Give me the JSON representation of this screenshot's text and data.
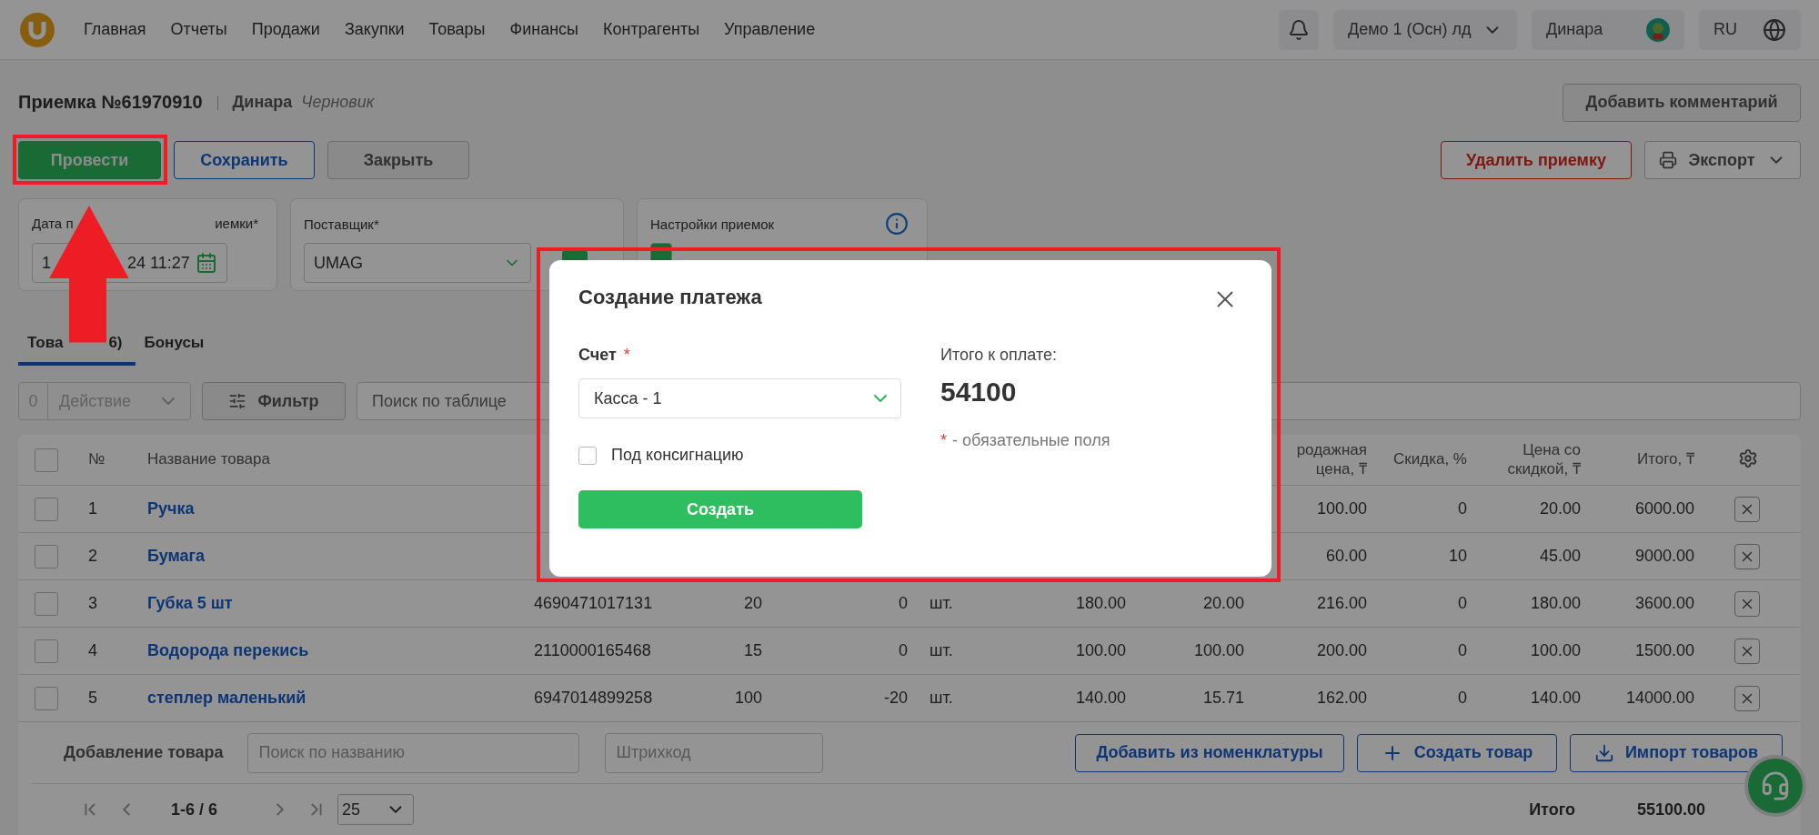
{
  "nav": {
    "items": [
      "Главная",
      "Отчеты",
      "Продажи",
      "Закупки",
      "Товары",
      "Финансы",
      "Контрагенты",
      "Управление"
    ],
    "organization": "Демо 1 (Осн) лд",
    "user": "Динара",
    "language": "RU"
  },
  "document": {
    "title": "Приемка №61970910",
    "author": "Динара",
    "status": "Черновик"
  },
  "buttons": {
    "conduct": "Провести",
    "save": "Сохранить",
    "close": "Закрыть",
    "add_comment": "Добавить комментарий",
    "delete": "Удалить приемку",
    "export": "Экспорт"
  },
  "cards": {
    "date": {
      "label_parts": [
        "Дата п",
        "иемки*"
      ],
      "value_parts": [
        "1",
        "24 11:27"
      ]
    },
    "supplier": {
      "label": "Поставщик*",
      "value": "UMAG"
    },
    "settings": {
      "label": "Настройки приемок",
      "checked": true
    }
  },
  "tabs": [
    {
      "label_parts": [
        "Това",
        "6)"
      ],
      "selected": true
    },
    {
      "label_parts": [
        "Бонусы"
      ],
      "selected": false
    }
  ],
  "toolbar": {
    "selected_count": "0",
    "action": "Действие",
    "filter": "Фильтр",
    "search_placeholder": "Поиск по таблице"
  },
  "table": {
    "select_all_checked": false,
    "columns": {
      "number": "№",
      "name": "Название товара",
      "sale_price": "родажная\nцена, ₸",
      "discount": "Скидка, %",
      "discounted_price": "Цена со\nскидкой, ₸",
      "total": "Итого, ₸"
    },
    "rows": [
      {
        "checked": false,
        "number": "1",
        "name": "Ручка",
        "sale_price": "100.00",
        "discount": "0",
        "discounted_price": "20.00",
        "total": "6000.00"
      },
      {
        "checked": false,
        "number": "2",
        "name": "Бумага",
        "sale_price": "60.00",
        "discount": "10",
        "discounted_price": "45.00",
        "total": "9000.00"
      },
      {
        "checked": false,
        "number": "3",
        "name": "Губка 5 шт",
        "barcode": "4690471017131",
        "quantity": "20",
        "column_6": "0",
        "unit": "шт.",
        "purchase_price": "180.00",
        "column_8": "20.00",
        "sale_price": "216.00",
        "discount": "0",
        "discounted_price": "180.00",
        "total": "3600.00"
      },
      {
        "checked": false,
        "number": "4",
        "name": "Водорода перекись",
        "barcode": "2110000165468",
        "quantity": "15",
        "column_6": "0",
        "unit": "шт.",
        "purchase_price": "100.00",
        "column_8": "100.00",
        "sale_price": "200.00",
        "discount": "0",
        "discounted_price": "100.00",
        "total": "1500.00"
      },
      {
        "checked": false,
        "number": "5",
        "name": "степлер маленький",
        "barcode": "6947014899258",
        "quantity": "100",
        "column_6": "-20",
        "unit": "шт.",
        "purchase_price": "140.00",
        "column_8": "15.71",
        "sale_price": "162.00",
        "discount": "0",
        "discounted_price": "140.00",
        "total": "14000.00"
      }
    ]
  },
  "add_product": {
    "label": "Добавление товара",
    "name_placeholder": "Поиск по названию",
    "barcode_placeholder": "Штрихкод",
    "from_catalog": "Добавить из номенклатуры",
    "create": "Создать товар",
    "import": "Импорт товаров"
  },
  "pagination": {
    "range": "1-6 / 6",
    "page_size": "25"
  },
  "summary": {
    "label": "Итого",
    "value": "55100.00"
  },
  "modal": {
    "title": "Создание платежа",
    "account_label": "Счет",
    "required_mark": "*",
    "account_value": "Касса - 1",
    "consignment_label": "Под консигнацию",
    "consignment_checked": false,
    "submit": "Создать",
    "total_label": "Итого к оплате:",
    "total_value": "54100",
    "note_mark": "*",
    "note": "- обязательные поля"
  }
}
